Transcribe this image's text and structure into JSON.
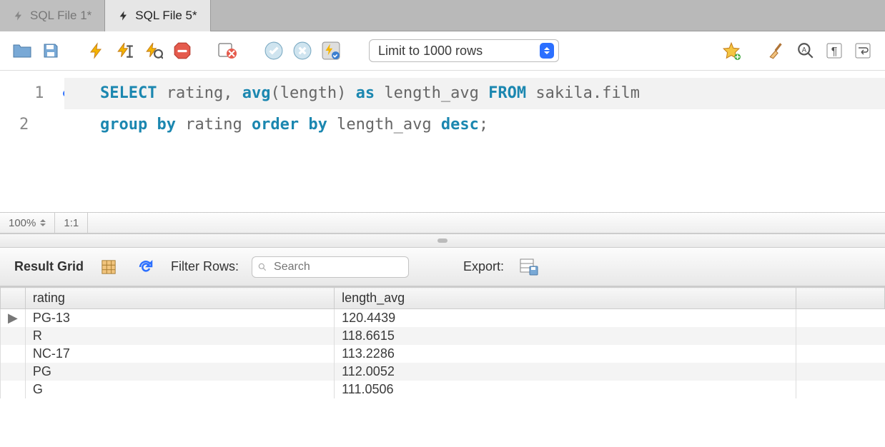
{
  "tabs": [
    {
      "label": "SQL File 1*"
    },
    {
      "label": "SQL File 5*"
    }
  ],
  "toolbar": {
    "limit_label": "Limit to 1000 rows"
  },
  "editor": {
    "line1_tokens": {
      "kw_select": "SELECT",
      "txt_rating": " rating, ",
      "fn_avg": "avg",
      "txt_length": "(length) ",
      "kw_as": "as",
      "txt_length_avg": " length_avg ",
      "kw_from": "FROM",
      "txt_table": " sakila.film"
    },
    "line2_tokens": {
      "kw_group_by": "group by",
      "txt_rating": " rating ",
      "kw_order_by": "order by",
      "txt_length_avg": " length_avg ",
      "kw_desc": "desc",
      "txt_semi": ";"
    }
  },
  "status": {
    "zoom": "100%",
    "pos": "1:1"
  },
  "result": {
    "grid_label": "Result Grid",
    "filter_label": "Filter Rows:",
    "filter_placeholder": "Search",
    "export_label": "Export:",
    "columns": [
      "rating",
      "length_avg"
    ],
    "rows": [
      {
        "rating": "PG-13",
        "length_avg": "120.4439"
      },
      {
        "rating": "R",
        "length_avg": "118.6615"
      },
      {
        "rating": "NC-17",
        "length_avg": "113.2286"
      },
      {
        "rating": "PG",
        "length_avg": "112.0052"
      },
      {
        "rating": "G",
        "length_avg": "111.0506"
      }
    ]
  }
}
